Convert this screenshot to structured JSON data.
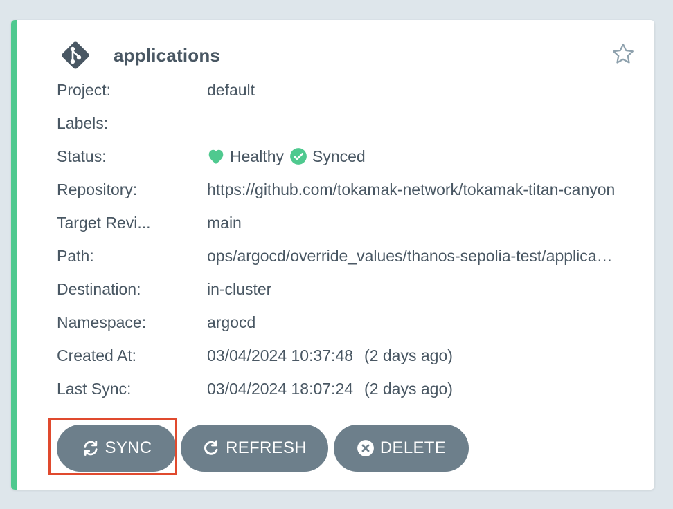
{
  "app": {
    "name": "applications",
    "health_color": "#4fc98f"
  },
  "details": [
    {
      "key": "project",
      "label": "Project:",
      "value": "default"
    },
    {
      "key": "labels",
      "label": "Labels:",
      "value": ""
    },
    {
      "key": "status",
      "label": "Status:",
      "health": "Healthy",
      "sync": "Synced"
    },
    {
      "key": "repository",
      "label": "Repository:",
      "value": "https://github.com/tokamak-network/tokamak-titan-canyon"
    },
    {
      "key": "target_revision",
      "label": "Target Revi...",
      "value": "main"
    },
    {
      "key": "path",
      "label": "Path:",
      "value": "ops/argocd/override_values/thanos-sepolia-test/applications"
    },
    {
      "key": "destination",
      "label": "Destination:",
      "value": "in-cluster"
    },
    {
      "key": "namespace",
      "label": "Namespace:",
      "value": "argocd"
    },
    {
      "key": "created_at",
      "label": "Created At:",
      "value": "03/04/2024 10:37:48",
      "ago": "(2 days ago)"
    },
    {
      "key": "last_sync",
      "label": "Last Sync:",
      "value": "03/04/2024 18:07:24",
      "ago": "(2 days ago)"
    }
  ],
  "actions": {
    "sync_label": "SYNC",
    "refresh_label": "REFRESH",
    "delete_label": "DELETE"
  },
  "icons": {
    "app_icon": "git-icon",
    "favorite": "star-icon",
    "health": "heart-icon",
    "sync_status": "check-circle-icon",
    "sync_button": "sync-icon",
    "refresh_button": "refresh-icon",
    "delete_button": "close-circle-icon"
  },
  "colors": {
    "highlight": "#e04a2e",
    "button_bg": "#6d7f8b",
    "text": "#495763"
  }
}
